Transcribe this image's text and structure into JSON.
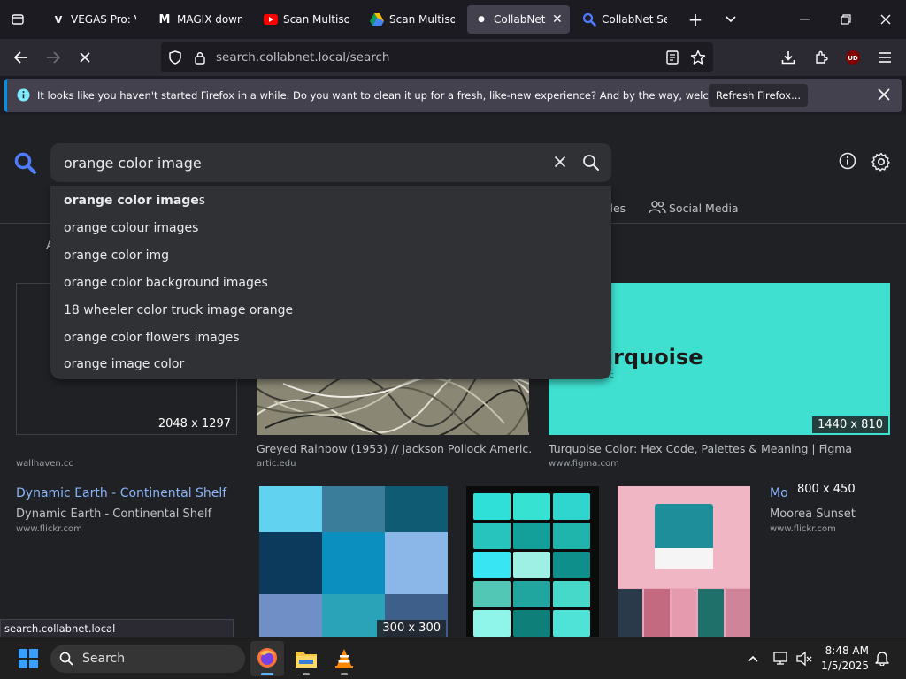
{
  "tabs": [
    {
      "label": "VEGAS Pro: Vi",
      "icon": "vegas-icon"
    },
    {
      "label": "MAGIX downl",
      "icon": "magix-icon"
    },
    {
      "label": "Scan Multisou",
      "icon": "youtube-icon"
    },
    {
      "label": "Scan Multisou",
      "icon": "drive-icon"
    },
    {
      "label": "CollabNet S",
      "icon": "loading-dot-icon"
    },
    {
      "label": "CollabNet Sea",
      "icon": "search-icon"
    }
  ],
  "url": "search.collabnet.local/search",
  "notification": {
    "text": "It looks like you haven't started Firefox in a while. Do you want to clean it up for a fresh, like-new experience? And by the way, welcome back!",
    "button": "Refresh Firefox..."
  },
  "search": {
    "query": "orange color image",
    "suggestion_first_bold": "orange color image",
    "suggestion_first_rest": "s",
    "suggestions": [
      "orange colour images",
      "orange color img",
      "orange color background images",
      "18 wheeler color truck image orange",
      "orange color flowers images",
      "orange image color"
    ]
  },
  "filters": {
    "files_partial": "iles",
    "social": "Social Media",
    "all_partial": "A"
  },
  "results": {
    "r1": {
      "dims": "2048 x 1297",
      "source": "wallhaven.cc"
    },
    "r2": {
      "title": "Greyed Rainbow (1953) // Jackson Pollock Americ...",
      "source": "artic.edu"
    },
    "r3": {
      "dims": "1440 x 810",
      "title": "Turquoise Color: Hex Code, Palettes & Meaning | Figma",
      "source": "www.figma.com",
      "image_text": "urquoise",
      "image_small": "DDC"
    },
    "r4": {
      "link": "Dynamic Earth - Continental Shelf",
      "title": "Dynamic Earth - Continental Shelf",
      "source": "www.flickr.com"
    },
    "r5": {
      "dims": "300 x 300"
    },
    "r6": {
      "link_partial": "Mo",
      "dims": "800 x 450",
      "title": "Moorea Sunset",
      "source": "www.flickr.com"
    }
  },
  "swatch_colors": [
    "#61d2f0",
    "#3a7d9a",
    "#0e5b73",
    "#0c3a5c",
    "#0b8fbe",
    "#8ab6e8",
    "#6f8fc6",
    "#2aa3b8",
    "#3e5f8a"
  ],
  "card_colors": [
    "#2ee0d8",
    "#36e3d2",
    "#2fd6cf",
    "#27c4be",
    "#139f9a",
    "#1fb5ad",
    "#37e5f3",
    "#9ef0e4",
    "#0e8f8b",
    "#52c7b6",
    "#21a69f",
    "#46d8c9",
    "#8ff5ea",
    "#0f7f7a",
    "#4fe3d7"
  ],
  "status_url": "search.collabnet.local",
  "taskbar": {
    "search_label": "Search",
    "time": "8:48 AM",
    "date": "1/5/2025"
  }
}
